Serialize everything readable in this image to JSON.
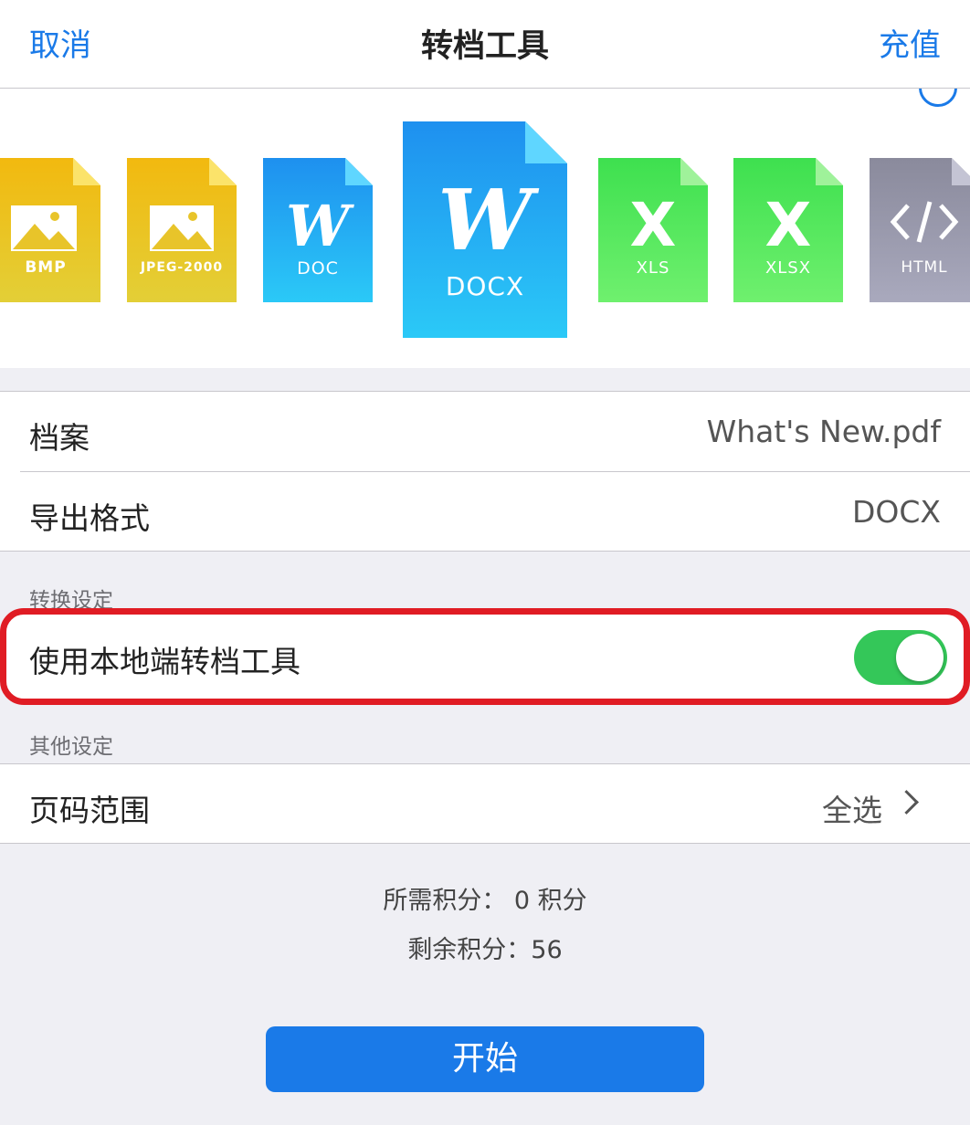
{
  "nav": {
    "cancel": "取消",
    "title": "转档工具",
    "recharge": "充值"
  },
  "formats": [
    {
      "id": "bmp",
      "label": "BMP",
      "color": "#e8c42a",
      "icon": "image-icon"
    },
    {
      "id": "jpeg2000",
      "label": "JPEG-2000",
      "color": "#e8c42a",
      "icon": "image-icon"
    },
    {
      "id": "doc",
      "label": "DOC",
      "color": "#23a6f2",
      "icon": "word-icon",
      "glyph": "W"
    },
    {
      "id": "docx",
      "label": "DOCX",
      "color": "#23a6f2",
      "icon": "word-icon",
      "glyph": "W",
      "selected": true
    },
    {
      "id": "xls",
      "label": "XLS",
      "color": "#4ee25e",
      "icon": "excel-icon",
      "glyph": "X"
    },
    {
      "id": "xlsx",
      "label": "XLSX",
      "color": "#4ee25e",
      "icon": "excel-icon",
      "glyph": "X"
    },
    {
      "id": "html",
      "label": "HTML",
      "color": "#9a9aae",
      "icon": "code-icon",
      "glyph": "</>"
    }
  ],
  "file": {
    "label": "档案",
    "value": "What's New.pdf"
  },
  "export": {
    "label": "导出格式",
    "value": "DOCX"
  },
  "conversion_settings": {
    "header": "转换设定",
    "local_tool_label": "使用本地端转档工具",
    "local_tool_enabled": true
  },
  "other_settings": {
    "header": "其他设定",
    "page_range_label": "页码范围",
    "page_range_value": "全选"
  },
  "credits": {
    "required": "所需积分： 0 积分",
    "remaining": "剩余积分：56"
  },
  "start_label": "开始",
  "colors": {
    "accent": "#1a7ae8",
    "switch_on": "#34c759",
    "highlight": "#e01c24"
  }
}
